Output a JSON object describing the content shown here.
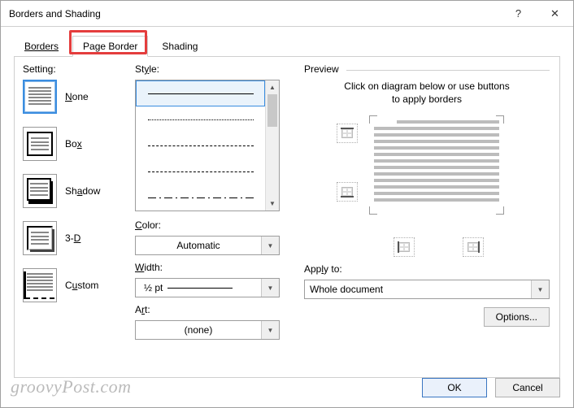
{
  "titlebar": {
    "title": "Borders and Shading",
    "help": "?",
    "close": "✕"
  },
  "tabs": {
    "borders": "Borders",
    "page_border": "Page Border",
    "shading": "Shading",
    "active": "page_border"
  },
  "setting": {
    "label": "Setting:",
    "none": "None",
    "box": "Box",
    "shadow": "Shadow",
    "threed": "3-D",
    "custom": "Custom"
  },
  "style": {
    "label": "Style:",
    "color_label": "Color:",
    "color_value": "Automatic",
    "width_label": "Width:",
    "width_value": "½ pt",
    "art_label": "Art:",
    "art_value": "(none)"
  },
  "preview": {
    "label": "Preview",
    "hint_line1": "Click on diagram below or use buttons",
    "hint_line2": "to apply borders",
    "apply_label": "Apply to:",
    "apply_value": "Whole document",
    "options": "Options..."
  },
  "footer": {
    "ok": "OK",
    "cancel": "Cancel"
  },
  "watermark": "groovyPost.com"
}
